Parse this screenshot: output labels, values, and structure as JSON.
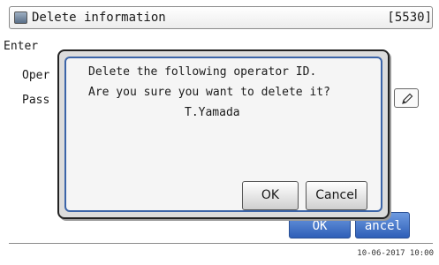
{
  "window": {
    "title": "Delete information",
    "screen_code": "[5530]"
  },
  "background": {
    "instruction_partial": "Enter",
    "field1_label_partial": "Oper",
    "field2_label_partial": "Pass",
    "ok_label": "OK",
    "cancel_label_partial": "ancel",
    "pencil_icon": "pencil-icon"
  },
  "dialog": {
    "line1": "Delete the following operator ID.",
    "line2": "Are you sure you want to delete it?",
    "operator_name": "T.Yamada",
    "ok_label": "OK",
    "cancel_label": "Cancel"
  },
  "status": {
    "datetime": "10-06-2017 10:00"
  }
}
